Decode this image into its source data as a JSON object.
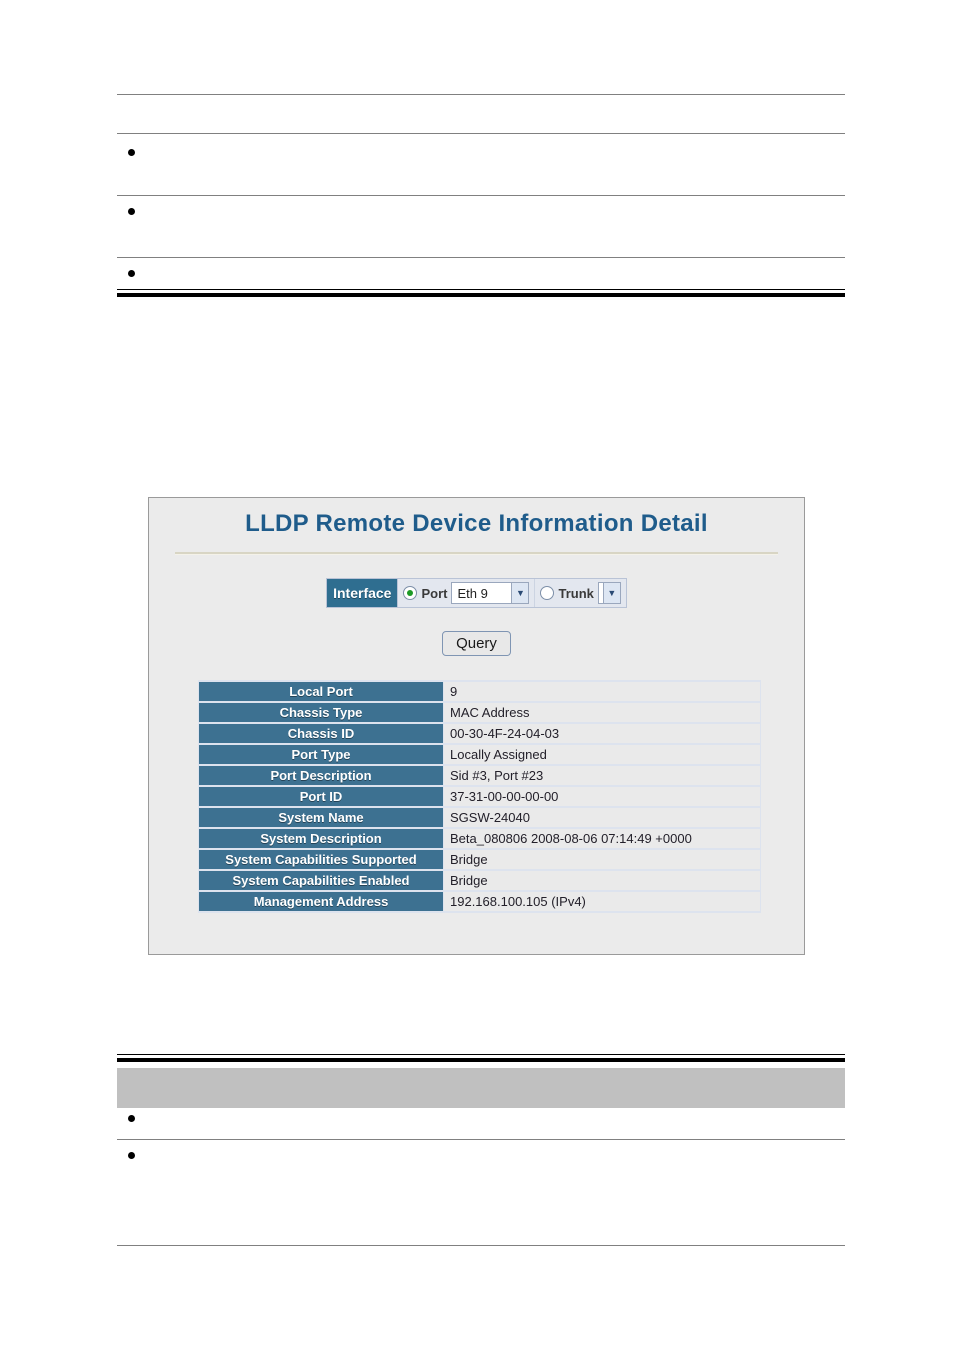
{
  "panel": {
    "title": "LLDP Remote Device Information Detail",
    "interface": {
      "label": "Interface",
      "port_radio_label": "Port",
      "port_selected": "Eth 9",
      "trunk_radio_label": "Trunk",
      "trunk_selected": "",
      "port_checked": true,
      "trunk_checked": false,
      "arrow_glyph": "▼"
    },
    "query_button": "Query",
    "details": [
      {
        "key": "Local Port",
        "value": "9"
      },
      {
        "key": "Chassis Type",
        "value": "MAC Address"
      },
      {
        "key": "Chassis ID",
        "value": "00-30-4F-24-04-03"
      },
      {
        "key": "Port Type",
        "value": "Locally Assigned"
      },
      {
        "key": "Port Description",
        "value": "Sid #3, Port #23"
      },
      {
        "key": "Port ID",
        "value": "37-31-00-00-00-00"
      },
      {
        "key": "System Name",
        "value": "SGSW-24040"
      },
      {
        "key": "System Description",
        "value": "Beta_080806 2008-08-06 07:14:49 +0000"
      },
      {
        "key": "System Capabilities Supported",
        "value": "Bridge"
      },
      {
        "key": "System Capabilities Enabled",
        "value": "Bridge"
      },
      {
        "key": "Management Address",
        "value": "192.168.100.105 (IPv4)"
      }
    ]
  },
  "colors": {
    "title_blue": "#1f5c8b",
    "key_cell_blue": "#3d7191",
    "interface_label_blue": "#2f6e90",
    "panel_background": "#ebebeb",
    "radio_dot_green": "#1d9a26",
    "band_gray": "#c0c0c0"
  }
}
